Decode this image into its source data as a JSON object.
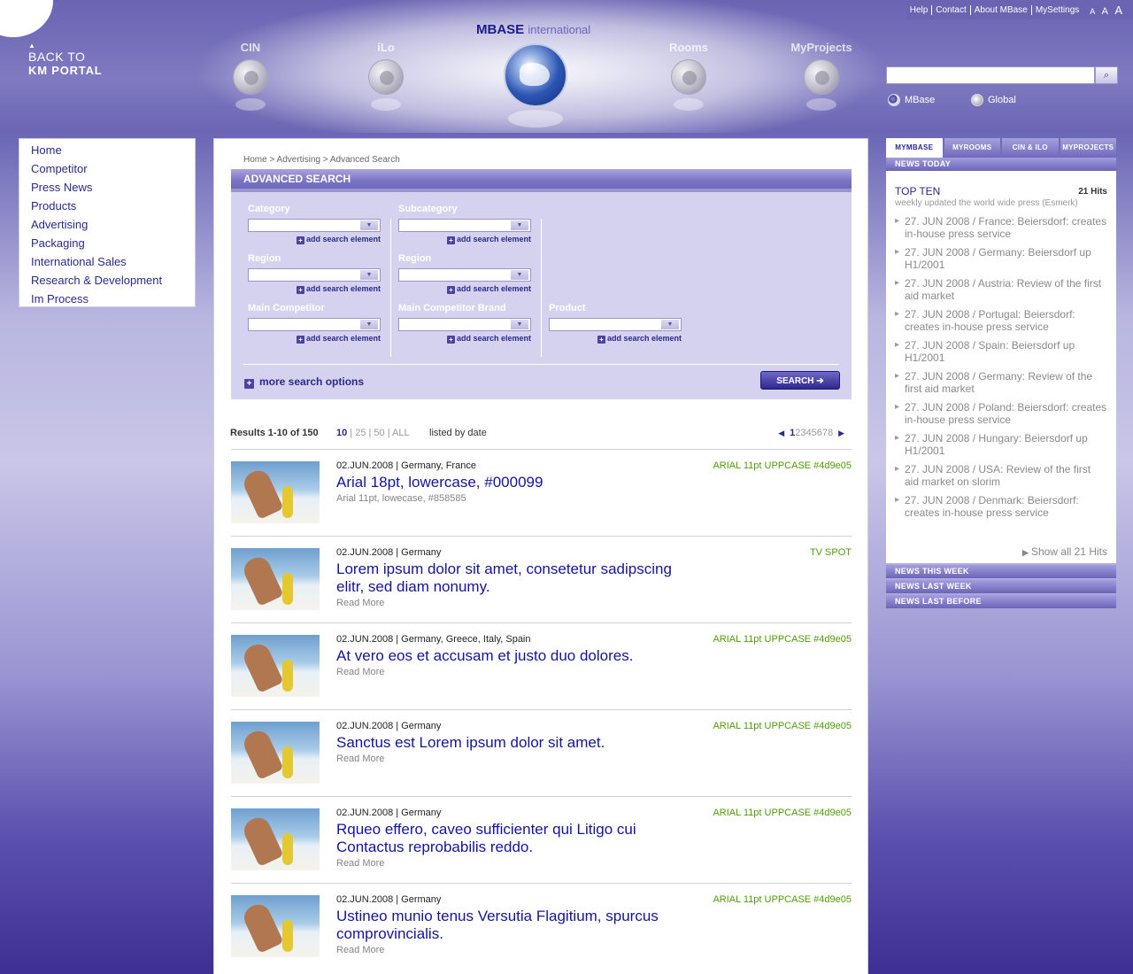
{
  "header": {
    "back_line1": "BACK TO",
    "back_line2": "KM PORTAL",
    "brand_main": "MBASE",
    "brand_sub": "international",
    "nav": [
      "CIN",
      "iLo",
      "Rooms",
      "MyProjects"
    ],
    "toplinks": [
      "Help",
      "Contact",
      "About MBase",
      "MySettings"
    ],
    "fontsizes": [
      "A",
      "A",
      "A"
    ],
    "search_placeholder": "",
    "search_button": "⌕",
    "scope_options": [
      "MBase",
      "Global"
    ],
    "scope_selected": "MBase"
  },
  "leftnav": [
    "Home",
    "Competitor",
    "Press News",
    "Products",
    "Advertising",
    "Packaging",
    "International Sales",
    "Research & Development",
    "Im Process"
  ],
  "breadcrumb": "Home > Advertising > Advanced Search",
  "advanced_search": {
    "title": "ADVANCED SEARCH",
    "add_label": "add search element",
    "fields": {
      "category": "Category",
      "subcategory": "Subcategory",
      "region1": "Region",
      "region2": "Region",
      "main_competitor": "Main Competitor",
      "main_competitor_brand": "Main Competitor Brand",
      "product": "Product"
    },
    "more_options": "more search options",
    "search_button": "SEARCH ➔"
  },
  "results": {
    "count_text": "Results 1-10 of 150",
    "per_page_current": "10",
    "per_page_rest": " | 25 | 50 | ALL",
    "sorted": "listed by date",
    "pages_current": "1",
    "pages_rest": "2345678",
    "items": [
      {
        "meta": "02.JUN.2008 | Germany, France",
        "tag": "ARIAL 11pt UPPCASE #4d9e05",
        "title": "Arial 18pt, lowercase, #000099",
        "sub": "Arial 11pt, lowecase, #858585"
      },
      {
        "meta": "02.JUN.2008 | Germany",
        "tag": "TV SPOT",
        "title": "Lorem ipsum dolor sit amet, consetetur sadipscing elitr, sed diam nonumy.",
        "sub": "Read More"
      },
      {
        "meta": "02.JUN.2008 | Germany, Greece, Italy, Spain",
        "tag": "ARIAL 11pt UPPCASE #4d9e05",
        "title": "At vero eos et accusam et justo duo dolores.",
        "sub": "Read More"
      },
      {
        "meta": "02.JUN.2008 | Germany",
        "tag": "ARIAL 11pt UPPCASE #4d9e05",
        "title": "Sanctus est Lorem ipsum dolor sit amet.",
        "sub": "Read More"
      },
      {
        "meta": "02.JUN.2008 | Germany",
        "tag": "ARIAL 11pt UPPCASE #4d9e05",
        "title": "Rqueo effero, caveo sufficienter qui Litigo cui Contactus reprobabilis reddo.",
        "sub": "Read More"
      },
      {
        "meta": "02.JUN.2008 | Germany",
        "tag": "ARIAL 11pt UPPCASE #4d9e05",
        "title": "Ustineo munio tenus Versutia Flagitium, spurcus comprovincialis.",
        "sub": "Read More"
      }
    ]
  },
  "right": {
    "tabs": [
      "MYMBASE",
      "MYROOMS",
      "CIN & ILO",
      "MYPROJECTS"
    ],
    "news_today": "NEWS TODAY",
    "top_ten": "TOP TEN",
    "hits": "21 Hits",
    "top_sub": "weekly updated the world wide press (Esmerk)",
    "news": [
      "27. JUN 2008 / France: Beiersdorf: creates in-house press service",
      "27. JUN 2008  / Germany: Beiersdorf up H1/2001",
      "27. JUN 2008 / Austria: Review of the first aid market",
      "27. JUN 2008 / Portugal: Beiersdorf: creates in-house press service",
      "27. JUN 2008 / Spain: Beiersdorf up H1/2001",
      "27. JUN 2008 / Germany: Review of the first aid market",
      "27. JUN 2008 / Poland: Beiersdorf: creates in-house press service",
      "27. JUN 2008 / Hungary: Beiersdorf up H1/2001",
      "27. JUN 2008 / USA: Review of the first aid market on slorim",
      "27. JUN 2008 / Denmark: Beiersdorf: creates in-house press service"
    ],
    "show_all": "Show all 21 Hits",
    "news_this_week": "NEWS THIS WEEK",
    "news_last_week": "NEWS LAST WEEK",
    "news_last_before": "NEWS LAST BEFORE"
  },
  "colors": {
    "brand": "#6a64b3",
    "title": "#000099",
    "tag": "#4d9e05",
    "muted": "#858585"
  }
}
